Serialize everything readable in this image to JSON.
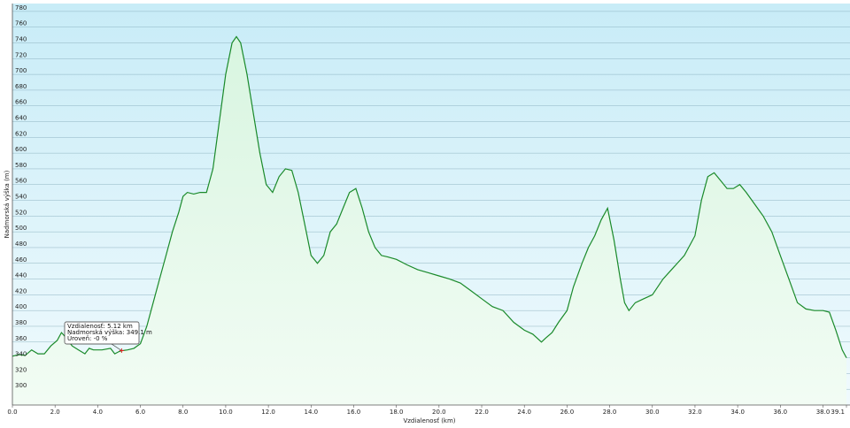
{
  "chart_data": {
    "type": "area",
    "xlabel": "Vzdialenosť (km)",
    "ylabel": "Nadmorská výška (m)",
    "xlim": [
      0,
      39.1
    ],
    "ylim": [
      280,
      790
    ],
    "x_ticks": [
      "0.0",
      "2.0",
      "4.0",
      "6.0",
      "8.0",
      "10.0",
      "12.0",
      "14.0",
      "16.0",
      "18.0",
      "20.0",
      "22.0",
      "24.0",
      "26.0",
      "28.0",
      "30.0",
      "32.0",
      "34.0",
      "36.0",
      "38.0",
      "39.1"
    ],
    "y_ticks": [
      "300",
      "320",
      "340",
      "360",
      "380",
      "400",
      "420",
      "440",
      "460",
      "480",
      "500",
      "520",
      "540",
      "560",
      "580",
      "600",
      "620",
      "640",
      "660",
      "680",
      "700",
      "720",
      "740",
      "760",
      "780"
    ],
    "grid": true,
    "colors": {
      "line": "#1a8a2a",
      "fill_top": "#d8f5e0",
      "fill_bottom": "#f2fcf4",
      "bg_top": "#c8ecf7",
      "bg_bottom": "#f0fafd",
      "grid": "#8fb4c2",
      "marker": "#e02020"
    },
    "series": [
      {
        "points": [
          [
            0.0,
            342
          ],
          [
            0.3,
            344
          ],
          [
            0.6,
            343
          ],
          [
            0.9,
            350
          ],
          [
            1.2,
            345
          ],
          [
            1.5,
            345
          ],
          [
            1.8,
            355
          ],
          [
            2.1,
            362
          ],
          [
            2.3,
            372
          ],
          [
            2.5,
            366
          ],
          [
            2.8,
            355
          ],
          [
            3.1,
            350
          ],
          [
            3.4,
            345
          ],
          [
            3.6,
            352
          ],
          [
            3.8,
            350
          ],
          [
            4.2,
            350
          ],
          [
            4.6,
            352
          ],
          [
            4.8,
            345
          ],
          [
            5.0,
            348
          ],
          [
            5.12,
            349
          ],
          [
            5.4,
            350
          ],
          [
            5.7,
            352
          ],
          [
            6.0,
            358
          ],
          [
            6.3,
            380
          ],
          [
            6.6,
            410
          ],
          [
            6.9,
            440
          ],
          [
            7.2,
            470
          ],
          [
            7.5,
            500
          ],
          [
            7.8,
            525
          ],
          [
            8.0,
            545
          ],
          [
            8.2,
            550
          ],
          [
            8.5,
            548
          ],
          [
            8.8,
            550
          ],
          [
            9.1,
            550
          ],
          [
            9.4,
            580
          ],
          [
            9.7,
            640
          ],
          [
            10.0,
            700
          ],
          [
            10.3,
            740
          ],
          [
            10.5,
            748
          ],
          [
            10.7,
            740
          ],
          [
            11.0,
            700
          ],
          [
            11.3,
            650
          ],
          [
            11.6,
            600
          ],
          [
            11.9,
            560
          ],
          [
            12.2,
            550
          ],
          [
            12.5,
            570
          ],
          [
            12.8,
            580
          ],
          [
            13.1,
            578
          ],
          [
            13.4,
            550
          ],
          [
            13.7,
            510
          ],
          [
            14.0,
            470
          ],
          [
            14.3,
            460
          ],
          [
            14.6,
            470
          ],
          [
            14.9,
            500
          ],
          [
            15.2,
            510
          ],
          [
            15.5,
            530
          ],
          [
            15.8,
            550
          ],
          [
            16.1,
            555
          ],
          [
            16.4,
            530
          ],
          [
            16.7,
            500
          ],
          [
            17.0,
            480
          ],
          [
            17.3,
            470
          ],
          [
            17.6,
            468
          ],
          [
            18.0,
            465
          ],
          [
            18.5,
            458
          ],
          [
            19.0,
            452
          ],
          [
            19.5,
            448
          ],
          [
            20.0,
            444
          ],
          [
            20.5,
            440
          ],
          [
            21.0,
            435
          ],
          [
            21.5,
            425
          ],
          [
            22.0,
            415
          ],
          [
            22.5,
            405
          ],
          [
            23.0,
            400
          ],
          [
            23.5,
            385
          ],
          [
            24.0,
            375
          ],
          [
            24.4,
            370
          ],
          [
            24.8,
            360
          ],
          [
            25.0,
            365
          ],
          [
            25.3,
            372
          ],
          [
            25.6,
            385
          ],
          [
            26.0,
            400
          ],
          [
            26.3,
            430
          ],
          [
            26.7,
            460
          ],
          [
            27.0,
            480
          ],
          [
            27.3,
            495
          ],
          [
            27.6,
            515
          ],
          [
            27.9,
            530
          ],
          [
            28.2,
            490
          ],
          [
            28.5,
            440
          ],
          [
            28.7,
            410
          ],
          [
            28.9,
            400
          ],
          [
            29.2,
            410
          ],
          [
            29.6,
            415
          ],
          [
            30.0,
            420
          ],
          [
            30.5,
            440
          ],
          [
            31.0,
            455
          ],
          [
            31.5,
            470
          ],
          [
            32.0,
            495
          ],
          [
            32.3,
            540
          ],
          [
            32.6,
            570
          ],
          [
            32.9,
            575
          ],
          [
            33.2,
            565
          ],
          [
            33.5,
            555
          ],
          [
            33.8,
            555
          ],
          [
            34.1,
            560
          ],
          [
            34.4,
            550
          ],
          [
            34.8,
            535
          ],
          [
            35.2,
            520
          ],
          [
            35.6,
            500
          ],
          [
            36.0,
            470
          ],
          [
            36.4,
            440
          ],
          [
            36.8,
            410
          ],
          [
            37.2,
            402
          ],
          [
            37.6,
            400
          ],
          [
            38.0,
            400
          ],
          [
            38.3,
            398
          ],
          [
            38.6,
            375
          ],
          [
            38.9,
            350
          ],
          [
            39.1,
            340
          ]
        ]
      }
    ],
    "tooltip": {
      "line1": "Vzdialenosť: 5.12 km",
      "line2": "Nadmorská výška: 349.1 m",
      "line3": "Úroveň: -0 %",
      "x": 5.12,
      "y": 349.1
    }
  }
}
